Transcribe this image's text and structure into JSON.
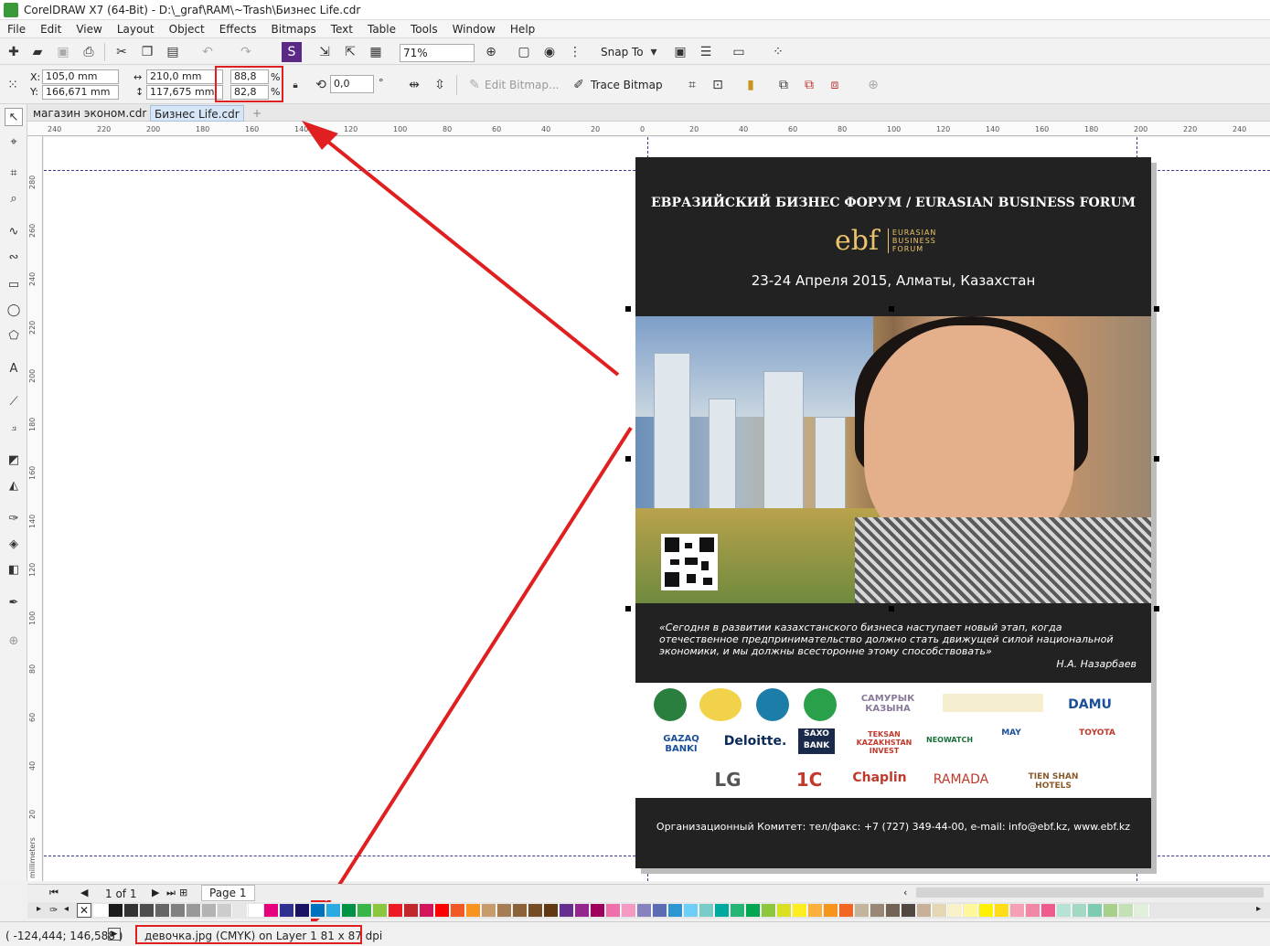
{
  "window": {
    "title": "CorelDRAW X7 (64-Bit) - D:\\_graf\\RAM\\~Trash\\Бизнес Life.cdr"
  },
  "menu": [
    "File",
    "Edit",
    "View",
    "Layout",
    "Object",
    "Effects",
    "Bitmaps",
    "Text",
    "Table",
    "Tools",
    "Window",
    "Help"
  ],
  "standard_toolbar": {
    "zoom": "71%",
    "snap_to": "Snap To"
  },
  "property_bar": {
    "x_label": "X:",
    "x": "105,0 mm",
    "y_label": "Y:",
    "y": "166,671 mm",
    "width": "210,0 mm",
    "height": "117,675 mm",
    "scale_w": "88,8",
    "scale_h": "82,8",
    "percent": "%",
    "rotation": "0,0",
    "degree": "°",
    "edit_bitmap": "Edit Bitmap...",
    "trace_bitmap": "Trace Bitmap"
  },
  "tabs": [
    "магазин эконом.cdr",
    "Бизнес Life.cdr"
  ],
  "ruler": {
    "h_ticks": [
      "240",
      "220",
      "200",
      "180",
      "160",
      "140",
      "120",
      "100",
      "80",
      "60",
      "40",
      "20",
      "0",
      "20",
      "40",
      "60",
      "80",
      "100",
      "120",
      "140",
      "160",
      "180",
      "200",
      "220",
      "240"
    ],
    "v_ticks": [
      "280",
      "260",
      "240",
      "220",
      "200",
      "180",
      "160",
      "140",
      "120",
      "100",
      "80",
      "60",
      "40",
      "20"
    ],
    "unit": "millimeters"
  },
  "document": {
    "forum_title": "ЕВРАЗИЙСКИЙ БИЗНЕС ФОРУМ / EURASIAN BUSINESS FORUM",
    "logo_main": "ebf",
    "logo_sub": [
      "EURASIAN",
      "BUSINESS",
      "FORUM"
    ],
    "date_line": "23-24 Апреля 2015, Алматы, Казахстан",
    "quote": "«Сегодня в развитии казахстанского бизнеса наступает новый этап, когда отечественное предпринимательство должно стать движущей силой национальной экономики, и мы должны всесторонне этому способствовать»",
    "quote_author": "Н.А. Назарбаев",
    "sponsors_row1": [
      "",
      "",
      "",
      "",
      "САМУРЫК КАЗЫНА",
      "",
      "DAMU"
    ],
    "sponsors_row2": [
      "GAZAQ BANKI",
      "Deloitte.",
      "SAXO BANK",
      "TEKSAN KAZAKHSTAN INVEST",
      "NEOWATCH",
      "MAY",
      "TOYOTA"
    ],
    "sponsors_row3": [
      "LG",
      "1С",
      "Chaplin",
      "RAMADA",
      "TIEN SHAN HOTELS"
    ],
    "footer": "Организационный Комитет: тел/факс: +7 (727) 349-44-00, e-mail: info@ebf.kz, www.ebf.kz"
  },
  "page_nav": {
    "count": "1 of 1",
    "page_tab": "Page 1"
  },
  "palette": [
    "#ffffff",
    "#1a1a1a",
    "#333333",
    "#4d4d4d",
    "#666666",
    "#808080",
    "#999999",
    "#b3b3b3",
    "#cccccc",
    "#e6e6e6",
    "#ffffff",
    "#e6007e",
    "#2e3192",
    "#1b1464",
    "#0071bc",
    "#29abe2",
    "#009245",
    "#39b54a",
    "#8cc63f",
    "#ed1c24",
    "#c1272d",
    "#d4145a",
    "#ff0000",
    "#f15a24",
    "#f7931e",
    "#c69c6d",
    "#a67c52",
    "#8c6239",
    "#754c24",
    "#603813",
    "#662d91",
    "#93278f",
    "#9e005d",
    "#ee6fa9",
    "#f49ac2",
    "#8781bd",
    "#5b6cb4",
    "#2e95d3",
    "#6dcff6",
    "#7accc8",
    "#00a99d",
    "#22b573",
    "#00a651",
    "#8dc73f",
    "#d9e021",
    "#fcee21",
    "#fbb03b",
    "#f7941d",
    "#f26522",
    "#c2b59b",
    "#998675",
    "#736357",
    "#534741",
    "#c7b299",
    "#e6d7b4",
    "#f9f1c7",
    "#fff799",
    "#fff200",
    "#ffde17",
    "#f6a1b3",
    "#f287a5",
    "#ef5a8f",
    "#b8e2d6",
    "#a3d9c2",
    "#7dcbb0",
    "#a8d08d",
    "#c5e0b4",
    "#e2efda"
  ],
  "status": {
    "coords": "( -124,444; 146,588 )",
    "object_info": "девочка.jpg (CMYK) on Layer 1 81 x 87 dpi"
  },
  "colors": {
    "annotation": "#e02020",
    "doc_bg": "#222222",
    "logo_gold": "#e9c46a"
  }
}
